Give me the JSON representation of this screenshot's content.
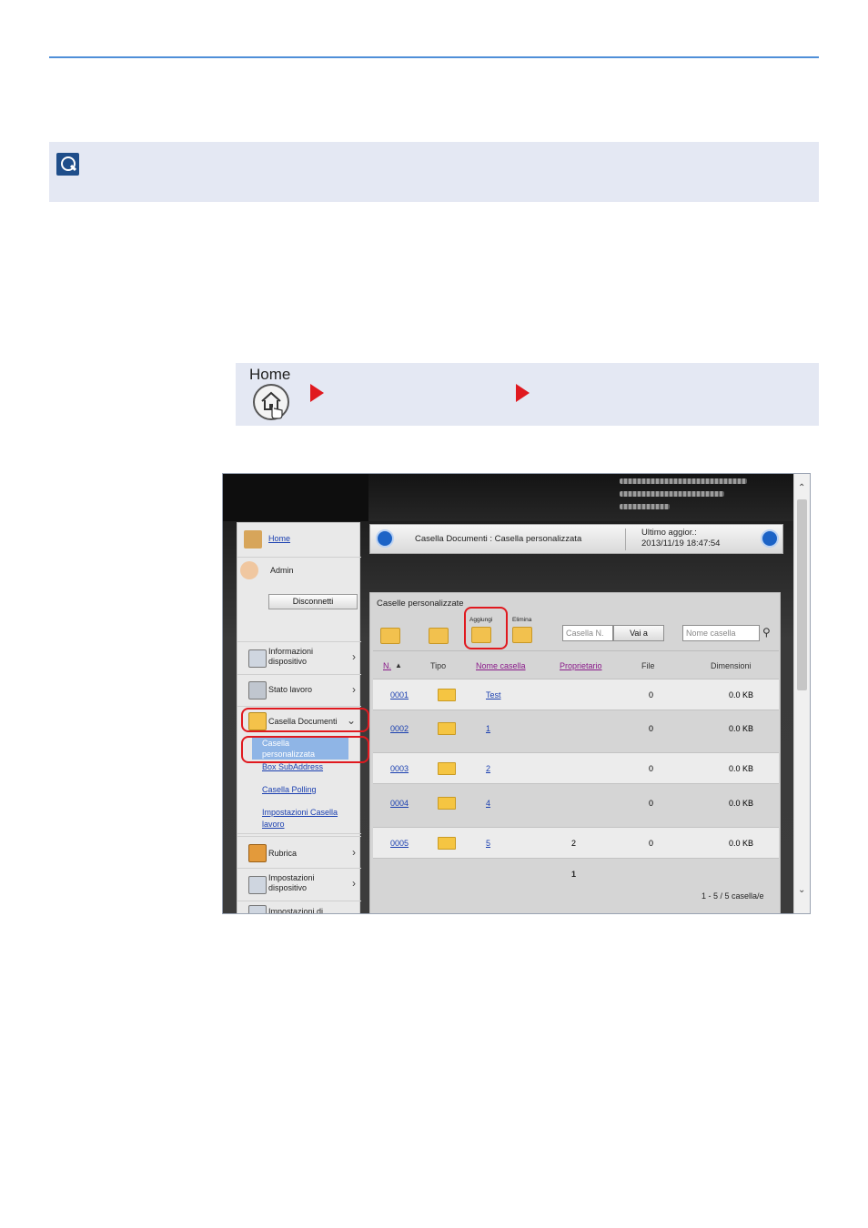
{
  "nav": {
    "home_label": "Home"
  },
  "sidebar": {
    "home": "Home",
    "admin": "Admin",
    "disconnect": "Disconnetti",
    "items": [
      {
        "label_line1": "Informazioni",
        "label_line2": "dispositivo"
      },
      {
        "label": "Stato lavoro"
      },
      {
        "label": "Casella Documenti"
      },
      {
        "label": "Rubrica"
      },
      {
        "label_line1": "Impostazioni",
        "label_line2": "dispositivo"
      },
      {
        "label": "Impostazioni di"
      }
    ],
    "sub_items": [
      {
        "label_line1": "Casella",
        "label_line2": "personalizzata"
      },
      {
        "label": "Box SubAddress"
      },
      {
        "label": "Casella Polling"
      },
      {
        "label_line1": "Impostazioni Casella",
        "label_line2": "lavoro"
      }
    ]
  },
  "header": {
    "breadcrumb": "Casella Documenti : Casella personalizzata",
    "last_update_label": "Ultimo aggior.:",
    "last_update_value": "2013/11/19 18:47:54"
  },
  "main": {
    "title": "Caselle personalizzate",
    "add_label": "Aggiungi",
    "delete_label": "Elimina",
    "box_no_placeholder": "Casella N.",
    "goto_label": "Vai a",
    "box_name_placeholder": "Nome casella",
    "columns": [
      "N.",
      "Tipo",
      "Nome casella",
      "Proprietario",
      "File",
      "Dimensioni"
    ],
    "rows": [
      {
        "no": "0001",
        "name": "Test",
        "owner": "",
        "files": "0",
        "size": "0.0 KB"
      },
      {
        "no": "0002",
        "name": "1",
        "owner": "",
        "files": "0",
        "size": "0.0 KB"
      },
      {
        "no": "0003",
        "name": "2",
        "owner": "",
        "files": "0",
        "size": "0.0 KB"
      },
      {
        "no": "0004",
        "name": "4",
        "owner": "",
        "files": "0",
        "size": "0.0 KB"
      },
      {
        "no": "0005",
        "name": "5",
        "owner": "2",
        "files": "0",
        "size": "0.0 KB"
      }
    ],
    "page_number": "1",
    "count_text": "1 - 5 / 5 casella/e"
  }
}
